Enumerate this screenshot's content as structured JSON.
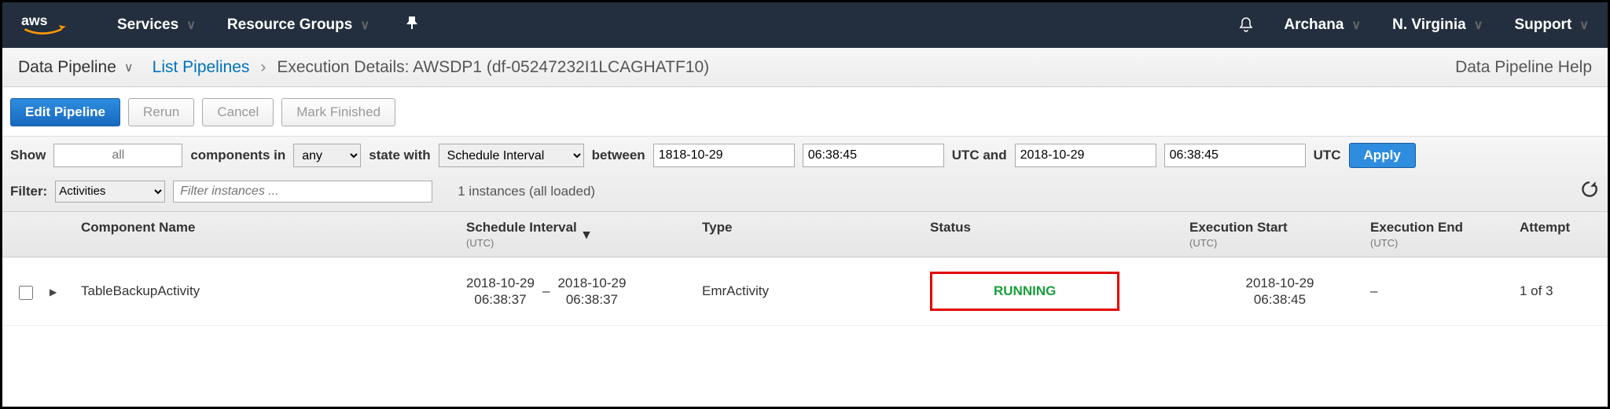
{
  "topnav": {
    "services": "Services",
    "resource_groups": "Resource Groups",
    "user": "Archana",
    "region": "N. Virginia",
    "support": "Support"
  },
  "breadcrumb": {
    "service": "Data Pipeline",
    "list": "List Pipelines",
    "title": "Execution Details: AWSDP1 (df-05247232I1LCAGHATF10)",
    "help": "Data Pipeline Help"
  },
  "toolbar": {
    "edit": "Edit Pipeline",
    "rerun": "Rerun",
    "cancel": "Cancel",
    "mark_finished": "Mark Finished"
  },
  "showrow": {
    "show": "Show",
    "all": "all",
    "components_in": "components in",
    "any": "any",
    "state_with": "state with",
    "schedule_interval": "Schedule Interval",
    "between": "between",
    "date1": "1818-10-29",
    "time1": "06:38:45",
    "utc_and": "UTC and",
    "date2": "2018-10-29",
    "time2": "06:38:45",
    "utc": "UTC",
    "apply": "Apply"
  },
  "filter": {
    "label": "Filter:",
    "type": "Activities",
    "placeholder": "Filter instances ...",
    "count": "1 instances (all loaded)"
  },
  "headers": {
    "component_name": "Component Name",
    "schedule_interval": "Schedule Interval",
    "utc": "(UTC)",
    "type": "Type",
    "status": "Status",
    "execution_start": "Execution Start",
    "execution_end": "Execution End",
    "attempt": "Attempt"
  },
  "rows": [
    {
      "name": "TableBackupActivity",
      "sched_start_d": "2018-10-29",
      "sched_start_t": "06:38:37",
      "sched_end_d": "2018-10-29",
      "sched_end_t": "06:38:37",
      "type": "EmrActivity",
      "status": "RUNNING",
      "exec_start_d": "2018-10-29",
      "exec_start_t": "06:38:45",
      "exec_end": "–",
      "attempt": "1 of 3"
    }
  ]
}
